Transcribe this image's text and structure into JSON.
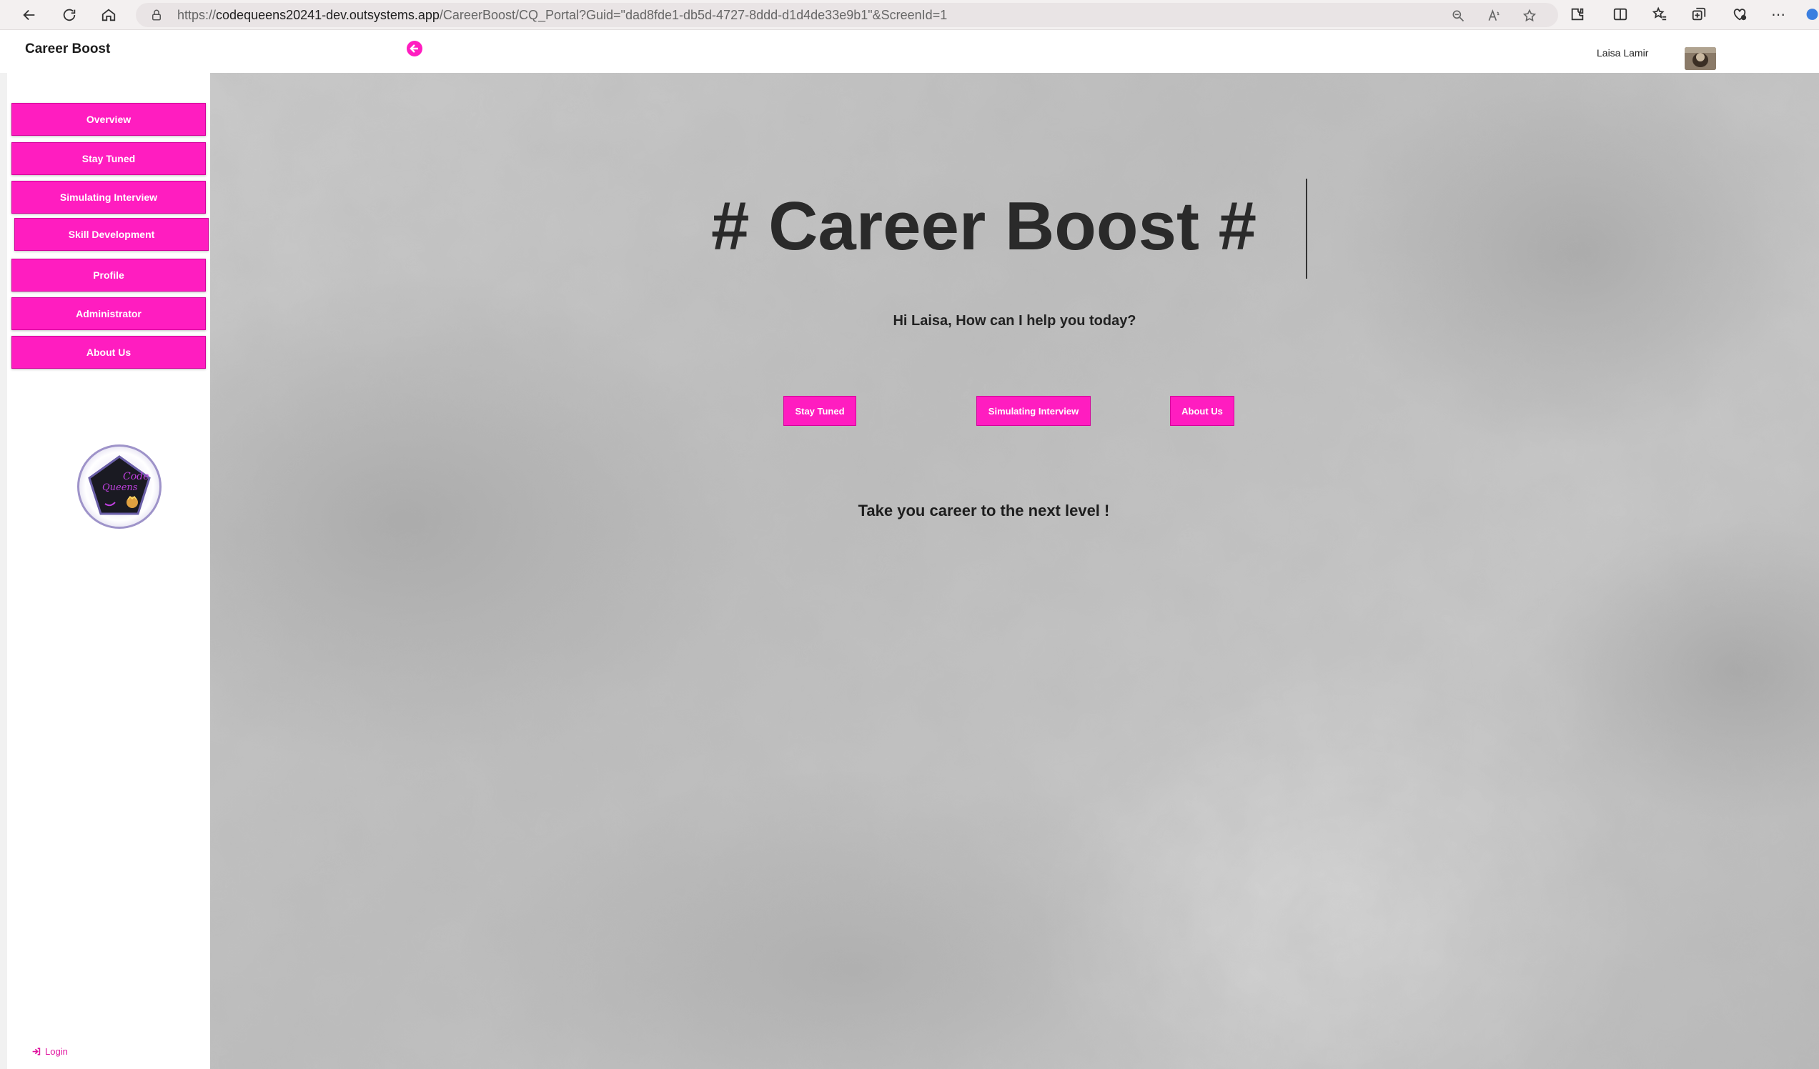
{
  "browser": {
    "url_prefix": "https://",
    "url_host": "codequeens20241-dev.outsystems.app",
    "url_path": "/CareerBoost/CQ_Portal?Guid=\"dad8fde1-db5d-4727-8ddd-d1d4de33e9b1\"&ScreenId=1"
  },
  "header": {
    "app_title": "Career Boost",
    "user_name": "Laisa Lamir"
  },
  "sidebar": {
    "items": [
      {
        "label": "Overview"
      },
      {
        "label": "Stay Tuned"
      },
      {
        "label": "Simulating Interview"
      },
      {
        "label": "Skill Development"
      },
      {
        "label": "Profile"
      },
      {
        "label": "Administrator"
      },
      {
        "label": "About Us"
      }
    ],
    "login_label": "Login"
  },
  "main": {
    "title": "# Career Boost #",
    "greeting": "Hi Laisa, How can I help you today?",
    "buttons": [
      {
        "label": "Stay Tuned"
      },
      {
        "label": "Simulating Interview"
      },
      {
        "label": "About Us"
      }
    ],
    "tagline": "Take you career to the next level !"
  },
  "colors": {
    "accent": "#ff1dc0",
    "background": "#c4c4c4"
  }
}
